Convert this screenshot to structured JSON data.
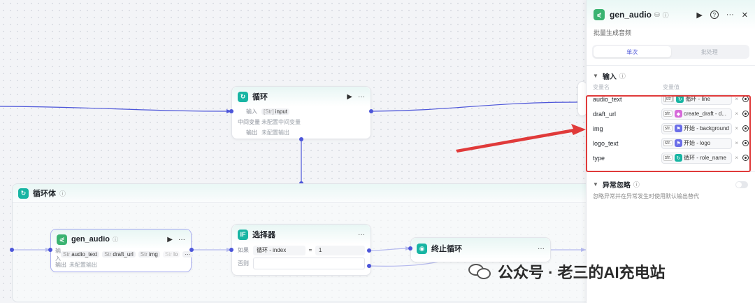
{
  "nodes": {
    "loop": {
      "title": "循环",
      "input_label": "输入",
      "input_type": "[Str]",
      "input_value": "input",
      "mid_label": "中间变量",
      "mid_value": "未配置中间变量",
      "output_label": "输出",
      "output_value": "未配置输出"
    },
    "loop_body": {
      "title": "循环体"
    },
    "gen_audio": {
      "title": "gen_audio",
      "input_label": "输入",
      "params": [
        {
          "type": "Str",
          "name": "audio_text"
        },
        {
          "type": "Str",
          "name": "draft_url"
        },
        {
          "type": "Str",
          "name": "img"
        },
        {
          "type": "Str",
          "name": "lo"
        }
      ],
      "more": "···",
      "output_label": "输出",
      "output_value": "未配置输出"
    },
    "selector": {
      "title": "选择器",
      "if_label": "如果",
      "cond_left": "循环 - index",
      "cond_op": "=",
      "cond_right": "1",
      "else_label": "否则"
    },
    "stop_loop": {
      "title": "终止循环"
    }
  },
  "panel": {
    "title": "gen_audio",
    "description": "批量生成音频",
    "tabs": [
      {
        "label": "单次",
        "active": true
      },
      {
        "label": "批处理",
        "active": false
      }
    ],
    "input_section": "输入",
    "col_name": "变量名",
    "col_value": "变量值",
    "variables": [
      {
        "name": "audio_text",
        "type": "[str]",
        "source_icon": "loop-icon",
        "source": "循环",
        "field": "line",
        "color": "#17b5a3"
      },
      {
        "name": "draft_url",
        "type": "str.",
        "source_icon": "plugin-icon",
        "source": "create_draft",
        "field": "d...",
        "color": "#d66ad9"
      },
      {
        "name": "img",
        "type": "str.",
        "source_icon": "start-icon",
        "source": "开始",
        "field": "background",
        "color": "#6b6ee8"
      },
      {
        "name": "logo_text",
        "type": "str.",
        "source_icon": "start-icon",
        "source": "开始",
        "field": "logo",
        "color": "#6b6ee8"
      },
      {
        "name": "type",
        "type": "str.",
        "source_icon": "loop-icon",
        "source": "循环",
        "field": "role_name",
        "color": "#17b5a3"
      }
    ],
    "exception_section": "异常忽略",
    "exception_desc": "忽略异常并在异常发生时使用默认输出替代"
  },
  "watermark": "公众号 · 老三的AI充电站",
  "colors": {
    "accent": "#4c55d9",
    "highlight": "#e03a3a",
    "arrow": "#e03a3a",
    "teal": "#17b5a3"
  }
}
